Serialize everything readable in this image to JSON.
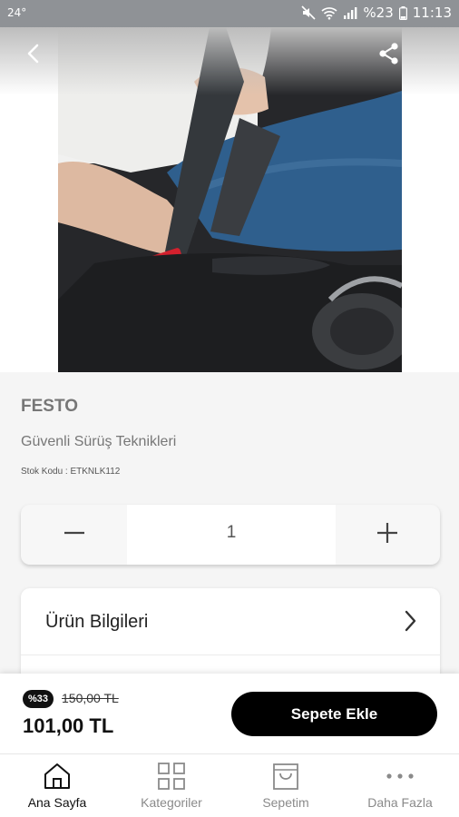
{
  "status_bar": {
    "temperature": "24°",
    "battery": "%23",
    "time": "11:13"
  },
  "product": {
    "brand": "FESTO",
    "name": "Güvenli Sürüş Teknikleri",
    "sku_label": "Stok Kodu :",
    "sku_value": "ETKNLK112",
    "image_alt": "Hand fastening a car seat belt"
  },
  "quantity": {
    "value": "1",
    "minus_icon": "minus-icon",
    "plus_icon": "plus-icon"
  },
  "info_section": {
    "label": "Ürün Bilgileri"
  },
  "purchase": {
    "discount_badge": "%33",
    "old_price": "150,00 TL",
    "price": "101,00 TL",
    "add_to_cart_label": "Sepete Ekle"
  },
  "bottom_nav": {
    "items": [
      {
        "label": "Ana Sayfa",
        "icon": "home-icon",
        "active": true
      },
      {
        "label": "Kategoriler",
        "icon": "grid-icon",
        "active": false
      },
      {
        "label": "Sepetim",
        "icon": "shopping-bag-icon",
        "active": false
      },
      {
        "label": "Daha Fazla",
        "icon": "more-icon",
        "active": false
      }
    ]
  },
  "colors": {
    "accent": "#000000",
    "status_bar": "#8f9296",
    "background": "#f5f5f5"
  }
}
